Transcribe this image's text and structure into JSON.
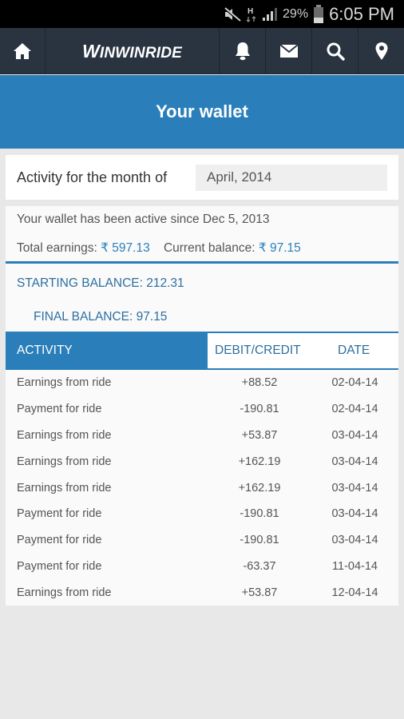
{
  "status_bar": {
    "icons": [
      "mute-icon",
      "hspa-data-icon",
      "signal-icon",
      "battery-icon"
    ],
    "battery_percent": "29%",
    "time": "6:05 PM"
  },
  "navbar": {
    "home_icon": "home-icon",
    "brand": "WinWinRide",
    "brand_display": "WINWINRIDE",
    "icons": [
      "bell-icon",
      "mail-icon",
      "search-icon",
      "location-pin-icon"
    ]
  },
  "header": {
    "title": "Your wallet"
  },
  "month": {
    "label": "Activity for the month of",
    "selected": "April, 2014"
  },
  "summary": {
    "active_since_text": "Your wallet has been active since Dec 5, 2013",
    "total_earnings_label": "Total earnings:",
    "total_earnings_value": "₹ 597.13",
    "current_balance_label": "Current balance:",
    "current_balance_value": "₹ 97.15"
  },
  "balances": {
    "starting_label": "STARTING BALANCE:",
    "starting_value": "212.31",
    "final_label": "FINAL BALANCE:",
    "final_value": "97.15"
  },
  "table": {
    "headers": {
      "activity": "ACTIVITY",
      "amount": "DEBIT/CREDIT",
      "date": "DATE"
    },
    "rows": [
      {
        "activity": "Earnings from ride",
        "amount": "+88.52",
        "date": "02-04-14"
      },
      {
        "activity": "Payment for ride",
        "amount": "-190.81",
        "date": "02-04-14"
      },
      {
        "activity": "Earnings from ride",
        "amount": "+53.87",
        "date": "03-04-14"
      },
      {
        "activity": "Earnings from ride",
        "amount": "+162.19",
        "date": "03-04-14"
      },
      {
        "activity": "Earnings from ride",
        "amount": "+162.19",
        "date": "03-04-14"
      },
      {
        "activity": "Payment for ride",
        "amount": "-190.81",
        "date": "03-04-14"
      },
      {
        "activity": "Payment for ride",
        "amount": "-190.81",
        "date": "03-04-14"
      },
      {
        "activity": "Payment for ride",
        "amount": "-63.37",
        "date": "11-04-14"
      },
      {
        "activity": "Earnings from ride",
        "amount": "+53.87",
        "date": "12-04-14"
      }
    ]
  },
  "colors": {
    "accent": "#2a7fbb",
    "navbar": "#2a3441",
    "background": "#e8e8e8"
  }
}
